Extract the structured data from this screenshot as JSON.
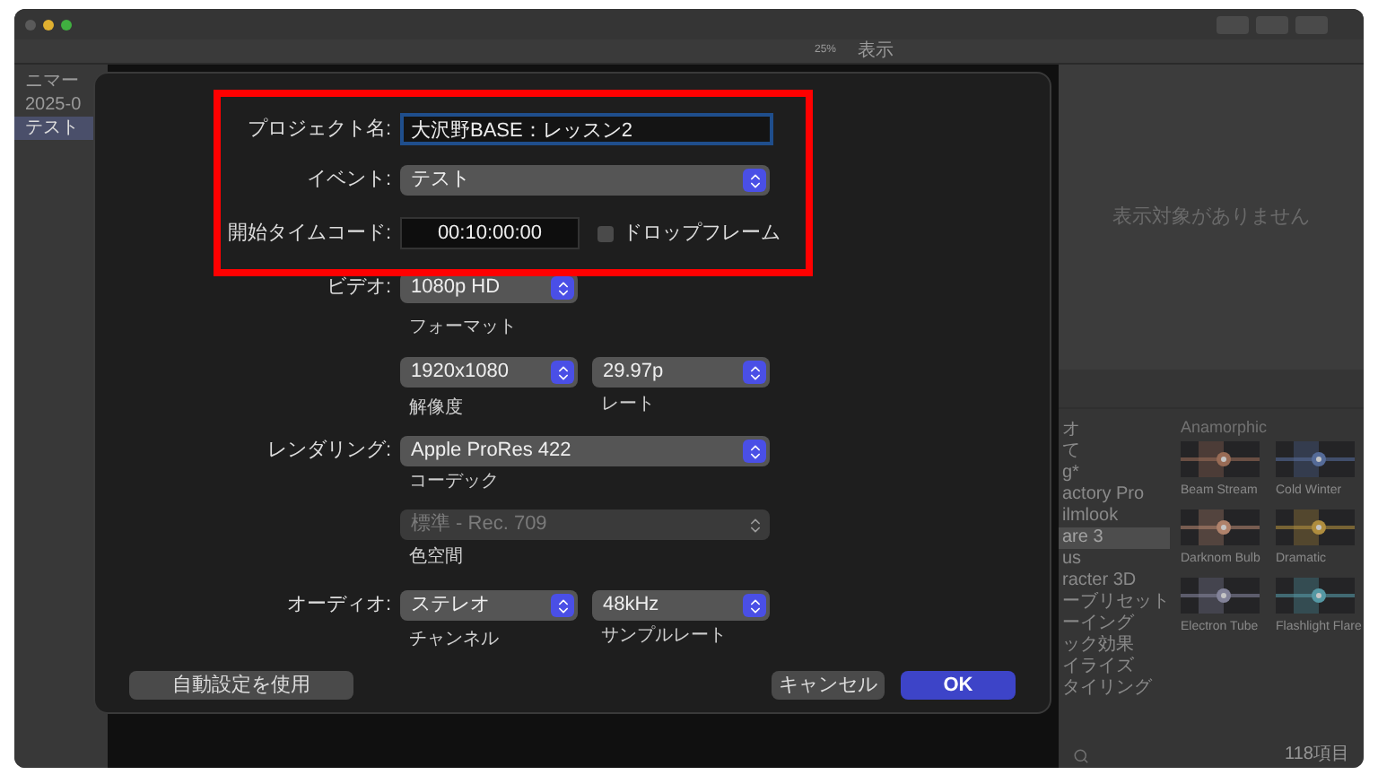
{
  "sidebar": {
    "items": [
      {
        "label": "ニマー",
        "selected": false
      },
      {
        "label": "2025-0",
        "selected": false
      },
      {
        "label": "テスト",
        "selected": true
      }
    ]
  },
  "viewer": {
    "zoom": "25%",
    "view_menu": "表示",
    "empty_message": "表示対象がありません"
  },
  "browser": {
    "categories": [
      {
        "label": "オ",
        "selected": false
      },
      {
        "label": "て",
        "selected": false
      },
      {
        "label": "g*",
        "selected": false
      },
      {
        "label": "actory Pro",
        "selected": false
      },
      {
        "label": "ilmlook",
        "selected": false
      },
      {
        "label": "are 3",
        "selected": true
      },
      {
        "label": "us",
        "selected": false
      },
      {
        "label": "racter 3D",
        "selected": false
      },
      {
        "label": "ーブリセット",
        "selected": false
      },
      {
        "label": "ーイング",
        "selected": false
      },
      {
        "label": "ック効果",
        "selected": false
      },
      {
        "label": "イライズ",
        "selected": false
      },
      {
        "label": "タイリング",
        "selected": false
      }
    ],
    "section": "Anamorphic",
    "tiles": [
      {
        "name": "Beam Stream"
      },
      {
        "name": "Cold Winter"
      },
      {
        "name": "Darknom Bulb"
      },
      {
        "name": "Dramatic"
      },
      {
        "name": "Electron Tube"
      },
      {
        "name": "Flashlight Flare"
      }
    ],
    "item_count": "118項目"
  },
  "dialog": {
    "project_name": {
      "label": "プロジェクト名:",
      "value": "大沢野BASE：レッスン2",
      "focused": true
    },
    "event": {
      "label": "イベント:",
      "value": "テスト",
      "disabled": false
    },
    "start_timecode": {
      "label": "開始タイムコード:",
      "value": "00:10:00:00"
    },
    "drop_frame": {
      "label": "ドロップフレーム",
      "checked": false
    },
    "video": {
      "label": "ビデオ:",
      "format": {
        "value": "1080p HD",
        "caption": "フォーマット",
        "disabled": false
      },
      "resolution": {
        "value": "1920x1080",
        "caption": "解像度",
        "disabled": false
      },
      "rate": {
        "value": "29.97p",
        "caption": "レート",
        "disabled": false
      }
    },
    "rendering": {
      "label": "レンダリング:",
      "codec": {
        "value": "Apple ProRes 422",
        "caption": "コーデック",
        "disabled": false
      },
      "color_space": {
        "value": "標準 - Rec. 709",
        "caption": "色空間",
        "disabled": true
      }
    },
    "audio": {
      "label": "オーディオ:",
      "channels": {
        "value": "ステレオ",
        "caption": "チャンネル",
        "disabled": false
      },
      "sample_rate": {
        "value": "48kHz",
        "caption": "サンプルレート",
        "disabled": false
      }
    },
    "buttons": [
      {
        "label": "自動設定を使用",
        "kind": "secondary"
      },
      {
        "label": "キャンセル",
        "kind": "secondary"
      },
      {
        "label": "OK",
        "kind": "primary"
      }
    ]
  }
}
